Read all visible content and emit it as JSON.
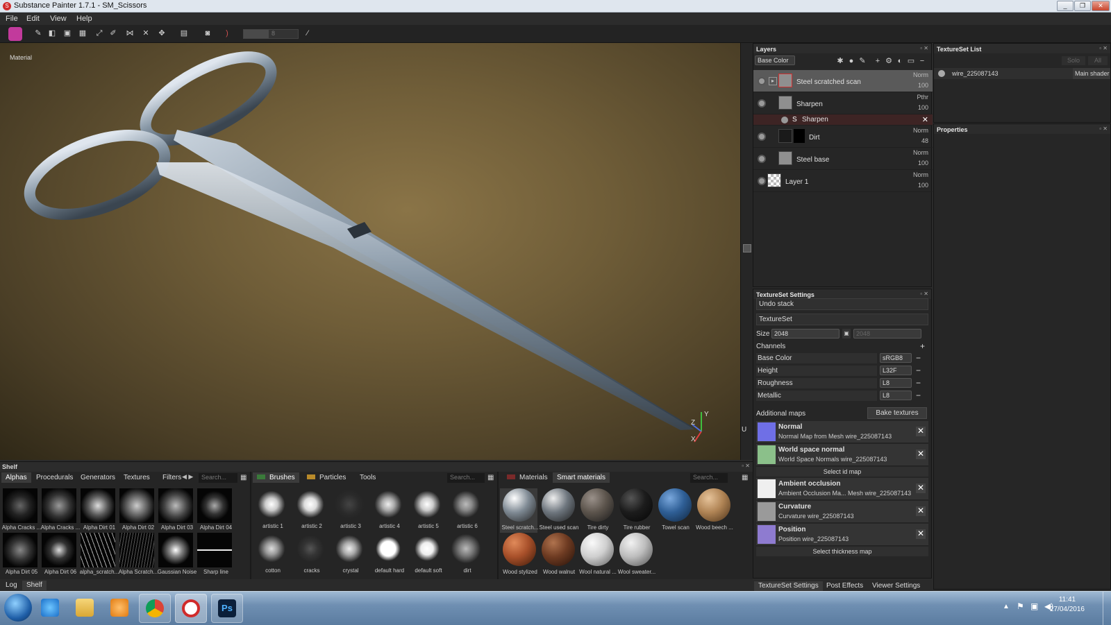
{
  "window": {
    "title": "Substance Painter 1.7.1 - SM_Scissors",
    "controls": [
      "_",
      "❐",
      "✕"
    ]
  },
  "menu": [
    "File",
    "Edit",
    "View",
    "Help"
  ],
  "toolbar": {
    "brush_size_value": "8"
  },
  "viewport": {
    "mode_label": "Material",
    "axis_x": "X",
    "axis_y": "Y",
    "axis_z": "Z",
    "side_u": "U"
  },
  "layers": {
    "title": "Layers",
    "channel_select": "Base Color",
    "rows": [
      {
        "name": "Steel scratched scan",
        "mode": "Norm",
        "opacity": "100",
        "selected": true
      },
      {
        "name": "Sharpen",
        "mode": "Pthr",
        "opacity": "100"
      },
      {
        "name": "Sharpen",
        "filter": true
      },
      {
        "name": "Dirt",
        "mode": "Norm",
        "opacity": "48"
      },
      {
        "name": "Steel base",
        "mode": "Norm",
        "opacity": "100"
      },
      {
        "name": "Layer 1",
        "mode": "Norm",
        "opacity": "100"
      }
    ]
  },
  "textureset_list": {
    "title": "TextureSet List",
    "solo": "Solo",
    "all": "All",
    "item": "wire_225087143",
    "shader": "Main shader"
  },
  "properties": {
    "title": "Properties"
  },
  "textureset_settings": {
    "title": "TextureSet Settings",
    "undo_stack": "Undo stack",
    "textureset": "TextureSet",
    "size_label": "Size",
    "size_value": "2048",
    "size_value2": "2048",
    "channels_label": "Channels",
    "channels": [
      {
        "name": "Base Color",
        "format": "sRGB8"
      },
      {
        "name": "Height",
        "format": "L32F"
      },
      {
        "name": "Roughness",
        "format": "L8"
      },
      {
        "name": "Metallic",
        "format": "L8"
      }
    ],
    "additional_maps": "Additional maps",
    "bake_textures": "Bake textures",
    "maps": [
      {
        "name": "Normal",
        "desc": "Normal Map from Mesh wire_225087143",
        "color": "#6f6fe6"
      },
      {
        "name": "World space normal",
        "desc": "World Space Normals wire_225087143",
        "color": "#8bc08a"
      },
      {
        "name": "Ambient occlusion",
        "desc": "Ambient Occlusion Ma... Mesh wire_225087143",
        "color": "#efefef"
      },
      {
        "name": "Curvature",
        "desc": "Curvature wire_225087143",
        "color": "#9a9a9a"
      },
      {
        "name": "Position",
        "desc": "Position wire_225087143",
        "color": "#8e7bd0"
      }
    ],
    "select_id_map": "Select id map",
    "select_thickness_map": "Select thickness map"
  },
  "right_bottom_tabs": [
    "TextureSet Settings",
    "Post Effects",
    "Viewer Settings"
  ],
  "shelf": {
    "title": "Shelf",
    "tabs": [
      "Alphas",
      "Procedurals",
      "Generators",
      "Textures",
      "Filters"
    ],
    "search_placeholder": "Search...",
    "alphas": [
      "Alpha Cracks ...",
      "Alpha Cracks ...",
      "Alpha Dirt 01",
      "Alpha Dirt 02",
      "Alpha Dirt 03",
      "Alpha Dirt 04",
      "Alpha Dirt 05",
      "Alpha Dirt 06",
      "alpha_scratch...",
      "Alpha Scratch...",
      "Gaussian Noise",
      "Sharp line"
    ],
    "brush_tabs": [
      "Brushes",
      "Particles",
      "Tools"
    ],
    "brushes": [
      "artistic 1",
      "artistic 2",
      "artistic 3",
      "artistic 4",
      "artistic 5",
      "artistic 6",
      "cotton",
      "cracks",
      "crystal",
      "default hard",
      "default soft",
      "dirt"
    ],
    "material_tabs": [
      "Materials",
      "Smart materials"
    ],
    "materials": [
      {
        "name": "Steel scratch...",
        "color": "#7f8a94"
      },
      {
        "name": "Steel used scan",
        "color": "#6e767e"
      },
      {
        "name": "Tire dirty",
        "color": "#5c544c"
      },
      {
        "name": "Tire rubber",
        "color": "#1c1c1c"
      },
      {
        "name": "Towel scan",
        "color": "#2f5f96"
      },
      {
        "name": "Wood beech ...",
        "color": "#b08455"
      },
      {
        "name": "Wood stylized",
        "color": "#a8502a"
      },
      {
        "name": "Wood walnut",
        "color": "#6e3b22"
      },
      {
        "name": "Wool natural ...",
        "color": "#cfcfcf"
      },
      {
        "name": "Wool sweater...",
        "color": "#bdbdbd"
      }
    ]
  },
  "log_tabs": [
    "Log",
    "Shelf"
  ],
  "taskbar": {
    "time": "11:41",
    "date": "27/04/2016"
  }
}
